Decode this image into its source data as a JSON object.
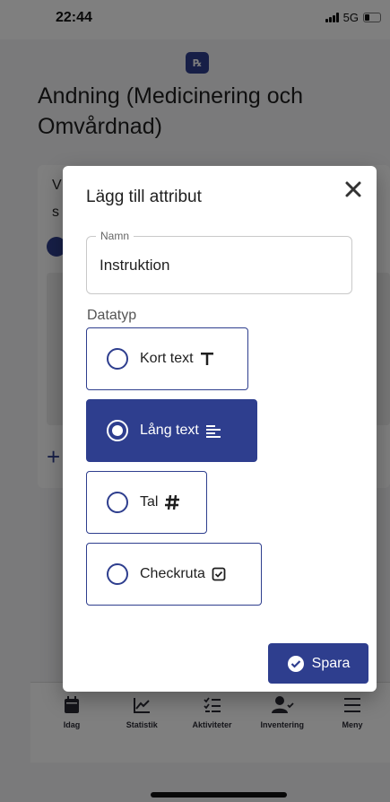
{
  "status_bar": {
    "time": "22:44",
    "network": "5G"
  },
  "background": {
    "title": "Andning (Medicinering och Omvårdnad)",
    "card_text": "V",
    "card_text2": "s",
    "add_symbol": "+"
  },
  "dialog": {
    "title": "Lägg till attribut",
    "name_field": {
      "legend": "Namn",
      "value": "Instruktion"
    },
    "datatype_label": "Datatyp",
    "options": [
      {
        "label": "Kort text",
        "icon": "text-type-icon",
        "selected": false
      },
      {
        "label": "Lång text",
        "icon": "long-text-icon",
        "selected": true
      },
      {
        "label": "Tal",
        "icon": "hash-icon",
        "selected": false
      },
      {
        "label": "Checkruta",
        "icon": "checkbox-icon",
        "selected": false
      }
    ],
    "save_label": "Spara"
  },
  "bottom_nav": [
    {
      "label": "Idag",
      "icon": "calendar-icon"
    },
    {
      "label": "Statistik",
      "icon": "chart-icon"
    },
    {
      "label": "Aktiviteter",
      "icon": "checklist-icon"
    },
    {
      "label": "Inventering",
      "icon": "user-check-icon"
    },
    {
      "label": "Meny",
      "icon": "menu-icon"
    }
  ],
  "colors": {
    "accent": "#2e3e8e",
    "overlay": "rgba(0,0,0,0.5)"
  }
}
